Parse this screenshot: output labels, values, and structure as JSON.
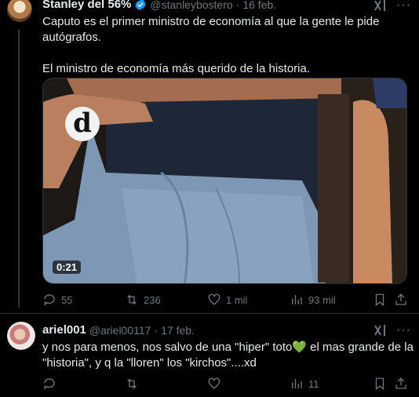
{
  "post1": {
    "author_name": "Stanley del 56%",
    "handle": "@stanleybostero",
    "sep": "·",
    "date": "16 feb.",
    "text_line1": "Caputo es el primer ministro de economía al que la gente le pide",
    "text_line2": "autógrafos.",
    "text_line3": "El ministro de economía más querido de la historia.",
    "video_duration": "0:21",
    "actions": {
      "replies": "55",
      "reposts": "236",
      "likes": "1 mil",
      "views": "93 mil"
    }
  },
  "post2": {
    "author_name": "ariel001",
    "handle": "@ariel00117",
    "sep": "·",
    "date": "17 feb.",
    "text_line1": "y nos para menos, nos salvo de una \"hiper\" toto💚 el mas grande de la",
    "text_line2": "\"historia\", y q la \"lloren\" los \"kirchos\"....xd",
    "actions": {
      "views": "11"
    }
  },
  "colors": {
    "background": "#000000",
    "text": "#e7e9ea",
    "muted": "#71767b",
    "verified": "#1d9bf0",
    "heart": "#3ec46d"
  },
  "icons": [
    "verified-badge-icon",
    "grok-icon",
    "more-icon",
    "reply-icon",
    "repost-icon",
    "like-icon",
    "views-icon",
    "bookmark-icon",
    "share-icon"
  ]
}
